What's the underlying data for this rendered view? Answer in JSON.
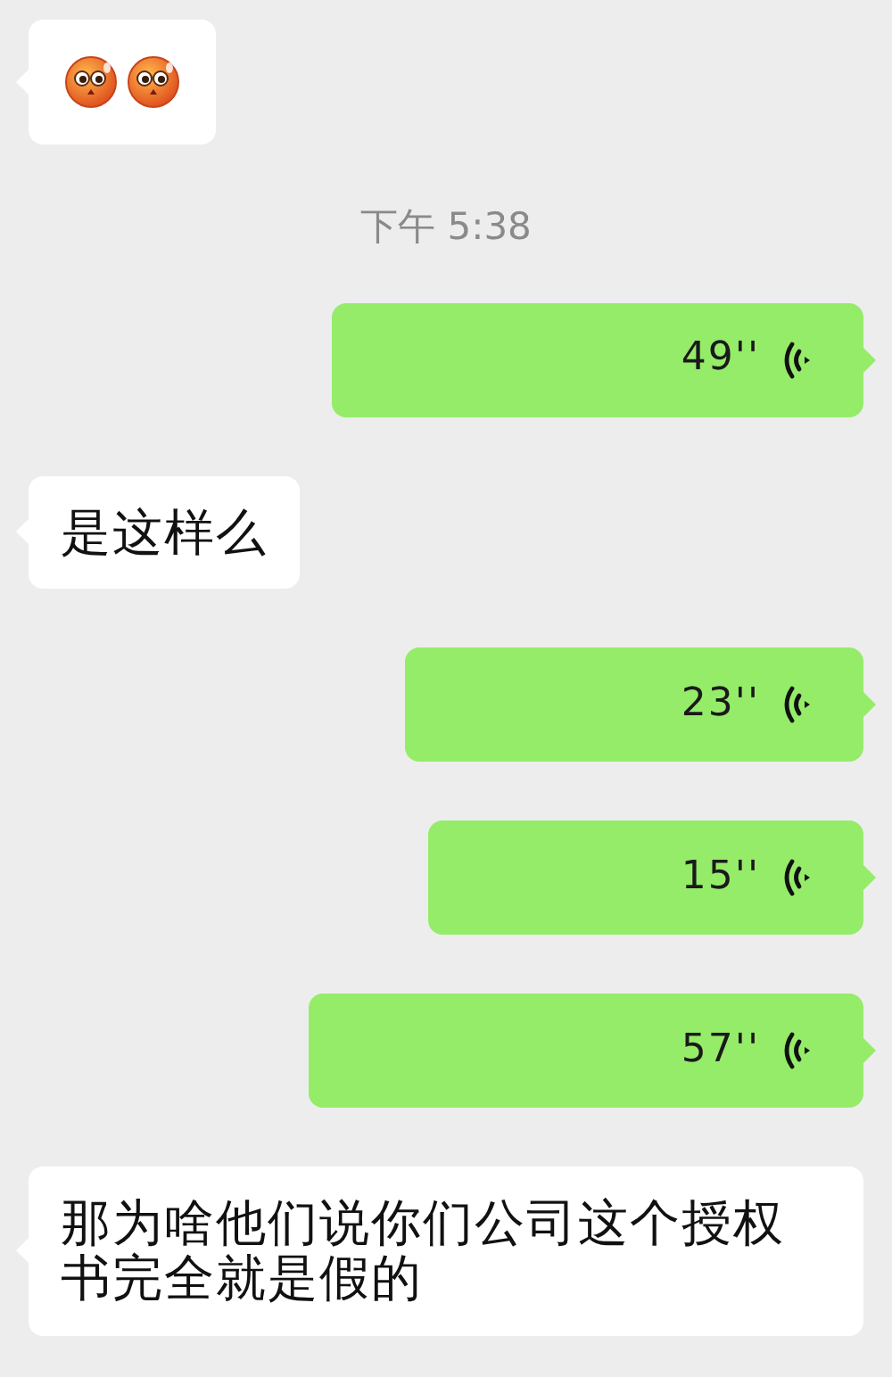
{
  "messages": [
    {
      "kind": "emoji",
      "outgoing": false
    },
    {
      "kind": "time",
      "text": "下午 5:38"
    },
    {
      "kind": "voice",
      "outgoing": true,
      "duration": "49''"
    },
    {
      "kind": "text",
      "outgoing": false,
      "text": "是这样么"
    },
    {
      "kind": "voice",
      "outgoing": true,
      "duration": "23''"
    },
    {
      "kind": "voice",
      "outgoing": true,
      "duration": "15''"
    },
    {
      "kind": "voice",
      "outgoing": true,
      "duration": "57''"
    },
    {
      "kind": "text",
      "outgoing": false,
      "text": "那为啥他们说你们公司这个授权书完全就是假的"
    }
  ]
}
